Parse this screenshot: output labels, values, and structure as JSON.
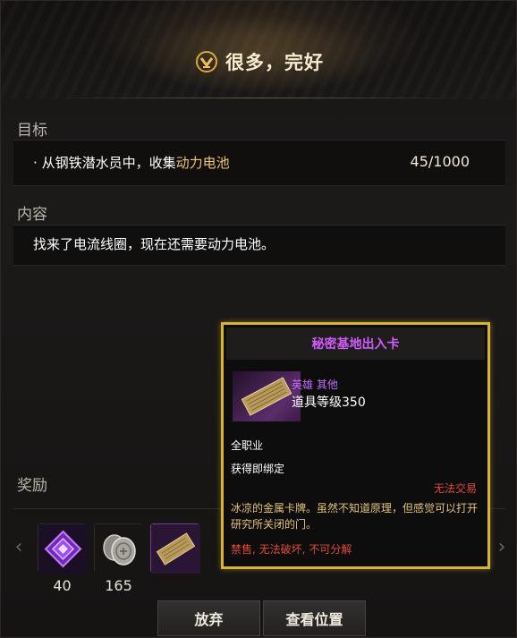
{
  "header": {
    "title": "很多，完好"
  },
  "objective": {
    "label": "目标",
    "bullet": "·",
    "text_prefix": "从钢铁潜水员中，收集",
    "text_highlight": "动力电池",
    "count": "45/1000"
  },
  "content": {
    "label": "内容",
    "text": "找来了电流线圈，现在还需要动力电池。"
  },
  "rewards": {
    "label": "奖励",
    "items": [
      {
        "icon": "purple-crystal-icon",
        "count": "40"
      },
      {
        "icon": "silver-coins-icon",
        "count": "165"
      },
      {
        "icon": "keycard-icon",
        "count": ""
      }
    ]
  },
  "buttons": {
    "abandon": "放弃",
    "view_location": "查看位置"
  },
  "tooltip": {
    "name": "秘密基地出入卡",
    "grade": "英雄 其他",
    "item_level": "道具等级350",
    "class": "全职业",
    "binding": "获得即绑定",
    "trade": "无法交易",
    "description": "冰凉的金属卡牌。虽然不知道原理，但感觉可以打开研究所关闭的门。",
    "flags": [
      "禁售",
      "无法破坏",
      "不可分解"
    ],
    "flag_separator": ", "
  },
  "colors": {
    "highlight": "#f0c673",
    "tooltip_border": "#d6b436",
    "hero_purple": "#c56bff",
    "warning_red": "#e24a3a",
    "description_gold": "#e6c37a"
  }
}
